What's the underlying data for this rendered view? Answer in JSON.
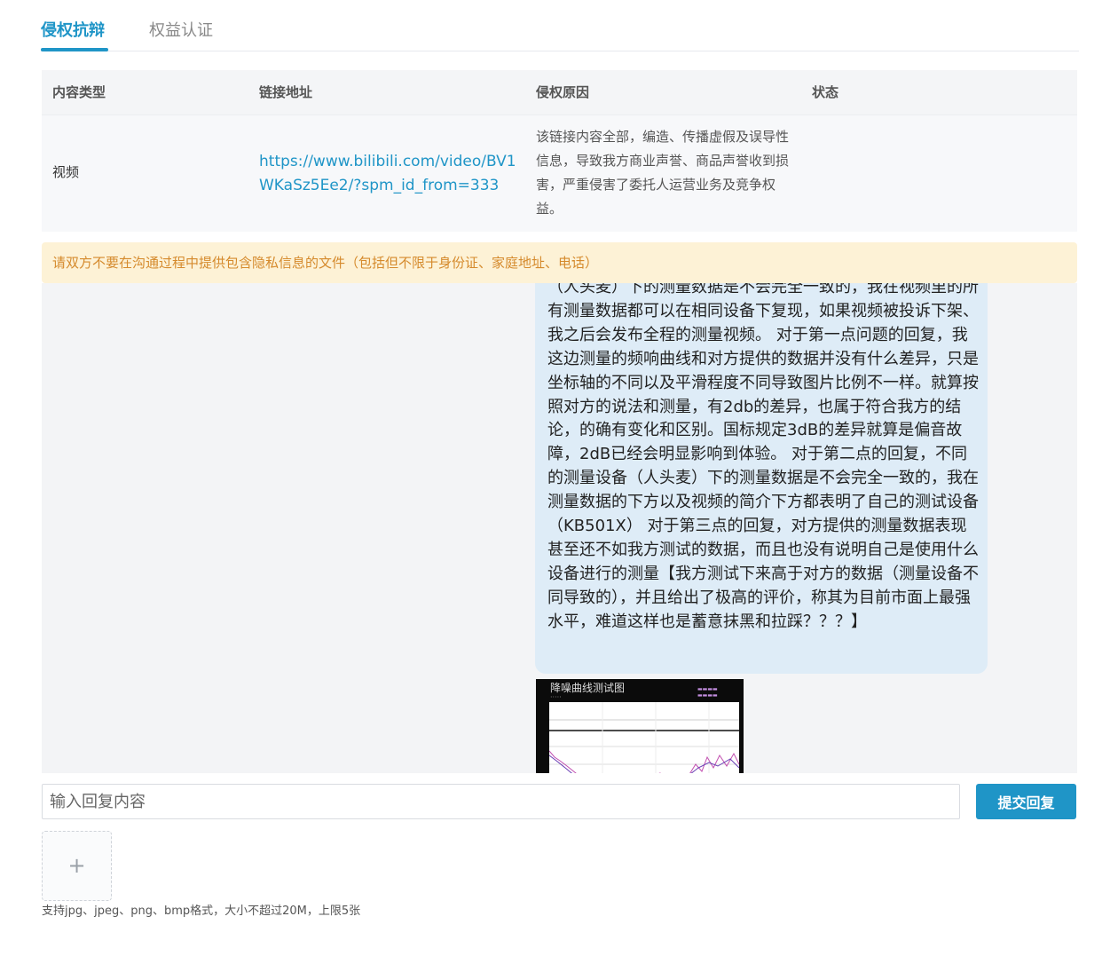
{
  "tabs": [
    {
      "label": "侵权抗辩",
      "active": true
    },
    {
      "label": "权益认证",
      "active": false
    }
  ],
  "table": {
    "headers": [
      "内容类型",
      "链接地址",
      "侵权原因",
      "状态"
    ],
    "rows": [
      {
        "type": "视频",
        "link": "https://www.bilibili.com/video/BV1WKaSz5Ee2/?spm_id_from=333",
        "reason": "该链接内容全部，编造、传播虚假及误导性信息，导致我方商业声誉、商品声誉收到损害，严重侵害了委托人运营业务及竞争权益。",
        "status": ""
      }
    ]
  },
  "notice": "请双方不要在沟通过程中提供包含隐私信息的文件（包括但不限于身份证、家庭地址、电话）",
  "message": {
    "text": "（人头麦）下的测量数据是不会完全一致的，我在视频里的所有测量数据都可以在相同设备下复现，如果视频被投诉下架、我之后会发布全程的测量视频。 对于第一点问题的回复，我这边测量的频响曲线和对方提供的数据并没有什么差异，只是坐标轴的不同以及平滑程度不同导致图片比例不一样。就算按照对方的说法和测量，有2db的差异，也属于符合我方的结论，的确有变化和区别。国标规定3dB的差异就算是偏音故障，2dB已经会明显影响到体验。 对于第二点的回复，不同的测量设备（人头麦）下的测量数据是不会完全一致的，我在测量数据的下方以及视频的简介下方都表明了自己的测试设备（KB501X） 对于第三点的回复，对方提供的测量数据表现甚至还不如我方测试的数据，而且也没有说明自己是使用什么设备进行的测量【我方测试下来高于对方的数据（测量设备不同导致的），并且给出了极高的评价，称其为目前市面上最强水平，难道这样也是蓄意抹黑和拉踩？？？】",
    "attachment_title": "降噪曲线测试图"
  },
  "reply": {
    "placeholder": "输入回复内容",
    "submit_label": "提交回复"
  },
  "upload": {
    "plus": "+",
    "hint": "支持jpg、jpeg、png、bmp格式，大小不超过20M，上限5张"
  },
  "colors": {
    "accent": "#1f95c7",
    "notice_bg": "#fdf2d6",
    "notice_text": "#d58a2c",
    "bubble_bg": "#deecf7"
  }
}
